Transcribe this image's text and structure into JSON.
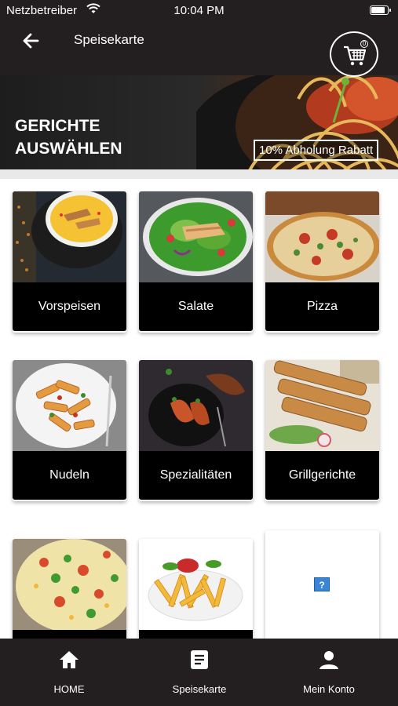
{
  "status_bar": {
    "carrier": "Netzbetreiber",
    "time": "10:04 PM",
    "battery_level": 0.92,
    "icons": [
      "wifi-icon",
      "battery-icon"
    ]
  },
  "header": {
    "title": "Speisekarte",
    "back_icon": "arrow-left-icon",
    "cart_icon": "cart-icon",
    "cart_count": "0"
  },
  "hero": {
    "title": "GERICHTE AUSWÄHLEN",
    "badge": "10% Abholung Rabatt"
  },
  "categories": [
    {
      "label": "Vorspeisen",
      "image": "soup-bowl"
    },
    {
      "label": "Salate",
      "image": "chicken-salad"
    },
    {
      "label": "Pizza",
      "image": "pizza"
    },
    {
      "label": "Nudeln",
      "image": "penne-pasta"
    },
    {
      "label": "Spezialitäten",
      "image": "stuffed-peppers"
    },
    {
      "label": "Grillgerichte",
      "image": "grilled-skewers"
    },
    {
      "label": "",
      "image": "vegetable-casserole"
    },
    {
      "label": "",
      "image": "french-fries"
    },
    {
      "label": "",
      "image": "missing-image",
      "placeholder": "?"
    }
  ],
  "bottom_nav": [
    {
      "label": "HOME",
      "icon": "home-icon"
    },
    {
      "label": "Speisekarte",
      "icon": "menu-list-icon"
    },
    {
      "label": "Mein Konto",
      "icon": "user-icon"
    }
  ],
  "colors": {
    "header_bg": "#231f20",
    "label_bg": "#000000",
    "accent_blue": "#3a85d6"
  }
}
